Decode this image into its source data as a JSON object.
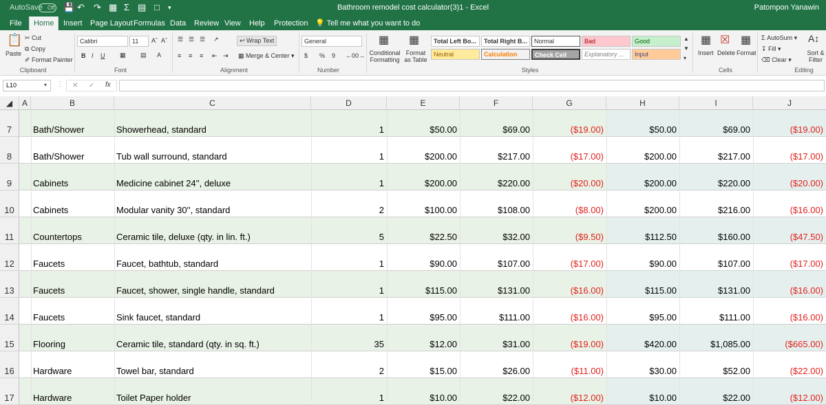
{
  "titlebar": {
    "autosave": "AutoSave",
    "toggle": "Off",
    "title": "Bathroom remodel cost calculator(3)1  -  Excel",
    "user": "Patompon Yanawin"
  },
  "tabs": [
    "File",
    "Home",
    "Insert",
    "Page Layout",
    "Formulas",
    "Data",
    "Review",
    "View",
    "Help",
    "Protection",
    "Tell me what you want to do"
  ],
  "ribbon": {
    "clipboard": {
      "paste": "Paste",
      "cut": "Cut",
      "copy": "Copy",
      "format_painter": "Format Painter",
      "label": "Clipboard"
    },
    "font": {
      "name": "Calibri",
      "size": "11",
      "bold": "B",
      "italic": "I",
      "underline": "U",
      "label": "Font"
    },
    "alignment": {
      "wrap_text": "Wrap Text",
      "merge_center": "Merge & Center",
      "label": "Alignment"
    },
    "number": {
      "format": "General",
      "currency": "$",
      "percent": "%",
      "comma": "9",
      "label": "Number"
    },
    "styles": {
      "conditional": "Conditional Formatting",
      "format_as_table": "Format as Table",
      "cells": [
        "Total Left Bo...",
        "Total Right B...",
        "Normal",
        "Bad",
        "Good",
        "Neutral",
        "Calculation",
        "Check Cell",
        "Explanatory ...",
        "Input"
      ],
      "label": "Styles"
    },
    "cells": {
      "insert": "Insert",
      "delete": "Delete",
      "format": "Format",
      "label": "Cells"
    },
    "editing": {
      "autosum": "AutoSum",
      "fill": "Fill",
      "clear": "Clear",
      "sort_filter": "Sort & Filter",
      "label": "Editing"
    }
  },
  "formula_bar": {
    "name_box": "L10",
    "formula": ""
  },
  "columns": [
    "A",
    "B",
    "C",
    "D",
    "E",
    "F",
    "G",
    "H",
    "I",
    "J"
  ],
  "rows": [
    {
      "num": "7",
      "b": "Bath/Shower",
      "c": "Showerhead, standard",
      "d": "1",
      "e": "$50.00",
      "f": "$69.00",
      "g": "($19.00)",
      "h": "$50.00",
      "i": "$69.00",
      "j": "($19.00)"
    },
    {
      "num": "8",
      "b": "Bath/Shower",
      "c": "Tub wall surround, standard",
      "d": "1",
      "e": "$200.00",
      "f": "$217.00",
      "g": "($17.00)",
      "h": "$200.00",
      "i": "$217.00",
      "j": "($17.00)"
    },
    {
      "num": "9",
      "b": "Cabinets",
      "c": "Medicine cabinet 24'', deluxe",
      "d": "1",
      "e": "$200.00",
      "f": "$220.00",
      "g": "($20.00)",
      "h": "$200.00",
      "i": "$220.00",
      "j": "($20.00)"
    },
    {
      "num": "10",
      "b": "Cabinets",
      "c": "Modular vanity 30'', standard",
      "d": "2",
      "e": "$100.00",
      "f": "$108.00",
      "g": "($8.00)",
      "h": "$200.00",
      "i": "$216.00",
      "j": "($16.00)"
    },
    {
      "num": "11",
      "b": "Countertops",
      "c": "Ceramic tile, deluxe (qty. in lin. ft.)",
      "d": "5",
      "e": "$22.50",
      "f": "$32.00",
      "g": "($9.50)",
      "h": "$112.50",
      "i": "$160.00",
      "j": "($47.50)"
    },
    {
      "num": "12",
      "b": "Faucets",
      "c": "Faucet, bathtub, standard",
      "d": "1",
      "e": "$90.00",
      "f": "$107.00",
      "g": "($17.00)",
      "h": "$90.00",
      "i": "$107.00",
      "j": "($17.00)"
    },
    {
      "num": "13",
      "b": "Faucets",
      "c": "Faucet, shower, single handle, standard",
      "d": "1",
      "e": "$115.00",
      "f": "$131.00",
      "g": "($16.00)",
      "h": "$115.00",
      "i": "$131.00",
      "j": "($16.00)"
    },
    {
      "num": "14",
      "b": "Faucets",
      "c": "Sink faucet, standard",
      "d": "1",
      "e": "$95.00",
      "f": "$111.00",
      "g": "($16.00)",
      "h": "$95.00",
      "i": "$111.00",
      "j": "($16.00)"
    },
    {
      "num": "15",
      "b": "Flooring",
      "c": "Ceramic tile, standard (qty. in sq. ft.)",
      "d": "35",
      "e": "$12.00",
      "f": "$31.00",
      "g": "($19.00)",
      "h": "$420.00",
      "i": "$1,085.00",
      "j": "($665.00)"
    },
    {
      "num": "16",
      "b": "Hardware",
      "c": "Towel bar, standard",
      "d": "2",
      "e": "$15.00",
      "f": "$26.00",
      "g": "($11.00)",
      "h": "$30.00",
      "i": "$52.00",
      "j": "($22.00)"
    },
    {
      "num": "17",
      "b": "Hardware",
      "c": "Toilet Paper holder",
      "d": "1",
      "e": "$10.00",
      "f": "$22.00",
      "g": "($12.00)",
      "h": "$10.00",
      "i": "$22.00",
      "j": "($12.00)"
    }
  ],
  "colors": {
    "accent": "#217346",
    "negative": "#e0201c",
    "band": "#e9f2e6",
    "band_alt": "#e5f0ee"
  }
}
